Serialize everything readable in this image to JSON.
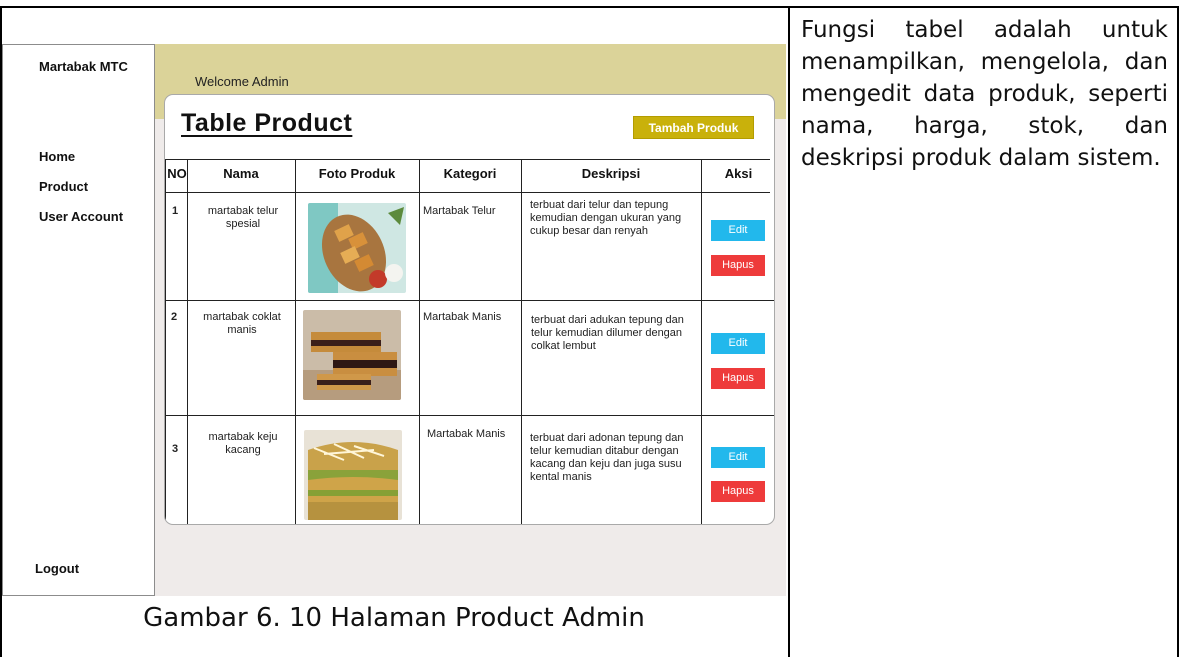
{
  "app": {
    "brand": "Martabak MTC",
    "welcome": "Welcome Admin"
  },
  "sidebar": {
    "items": [
      {
        "label": "Home"
      },
      {
        "label": "Product"
      },
      {
        "label": "User Account"
      }
    ],
    "logout": "Logout"
  },
  "main": {
    "title": "Table Product",
    "add_button": "Tambah Produk",
    "columns": [
      "NO",
      "Nama",
      "Foto Produk",
      "Kategori",
      "Deskripsi",
      "Aksi"
    ],
    "rows": [
      {
        "no": "1",
        "nama": "martabak telur spesial",
        "kategori": "Martabak Telur",
        "deskripsi": "terbuat dari telur dan tepung kemudian dengan ukuran yang cukup besar dan renyah",
        "edit": "Edit",
        "hapus": "Hapus"
      },
      {
        "no": "2",
        "nama": "martabak coklat manis",
        "kategori": "Martabak Manis",
        "deskripsi": "terbuat dari adukan tepung dan telur kemudian dilumer dengan colkat lembut",
        "edit": "Edit",
        "hapus": "Hapus"
      },
      {
        "no": "3",
        "nama": "martabak keju kacang",
        "kategori": "Martabak Manis",
        "deskripsi": "terbuat dari adonan tepung dan telur kemudian ditabur dengan kacang dan keju dan juga susu kental manis",
        "edit": "Edit",
        "hapus": "Hapus"
      }
    ]
  },
  "document": {
    "caption": "Gambar 6. 10 Halaman Product Admin",
    "description": "Fungsi tabel adalah untuk menampilkan, mengelola, dan mengedit data produk, seperti nama, harga, stok, dan deskripsi produk dalam sistem."
  },
  "colors": {
    "topbar": "#dbd399",
    "add_button": "#c9b10b",
    "edit_button": "#22b8ec",
    "delete_button": "#ee3b3b"
  }
}
